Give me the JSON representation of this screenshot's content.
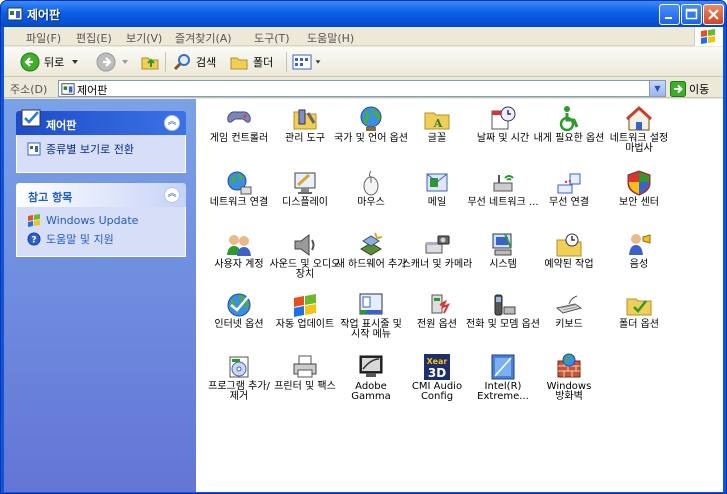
{
  "window": {
    "title": "제어판"
  },
  "menu": [
    "파일(F)",
    "편집(E)",
    "보기(V)",
    "즐겨찾기(A)",
    "도구(T)",
    "도움말(H)"
  ],
  "toolbar": {
    "back": "뒤로",
    "search": "검색",
    "folders": "폴더"
  },
  "address": {
    "label": "주소(D)",
    "value": "제어판",
    "go": "이동"
  },
  "sidebar": {
    "panel1": {
      "title": "제어판",
      "link": "종류별 보기로 전환"
    },
    "panel2": {
      "title": "참고 항목",
      "links": [
        "Windows Update",
        "도움말 및 지원"
      ]
    }
  },
  "items": [
    {
      "label": "게임 컨트롤러",
      "icon": "game-controller-icon"
    },
    {
      "label": "관리 도구",
      "icon": "admin-tools-icon"
    },
    {
      "label": "국가 및 언어 옵션",
      "icon": "globe-icon"
    },
    {
      "label": "글꼴",
      "icon": "fonts-folder-icon"
    },
    {
      "label": "날짜 및 시간",
      "icon": "clock-icon"
    },
    {
      "label": "내게 필요한 옵션",
      "icon": "accessibility-icon"
    },
    {
      "label": "네트워크 설정 마법사",
      "icon": "network-house-icon"
    },
    {
      "label": "네트워크 연결",
      "icon": "network-globe-icon"
    },
    {
      "label": "디스플레이",
      "icon": "display-icon"
    },
    {
      "label": "마우스",
      "icon": "mouse-icon"
    },
    {
      "label": "메일",
      "icon": "mail-icon"
    },
    {
      "label": "무선 네트워크 ...",
      "icon": "wireless-network-icon"
    },
    {
      "label": "무선 연결",
      "icon": "wireless-link-icon"
    },
    {
      "label": "보안 센터",
      "icon": "shield-icon"
    },
    {
      "label": "사용자 계정",
      "icon": "users-icon"
    },
    {
      "label": "사운드 및 오디오 장치",
      "icon": "speaker-icon"
    },
    {
      "label": "새 하드웨어 추가",
      "icon": "hardware-icon"
    },
    {
      "label": "스캐너 및 카메라",
      "icon": "scanner-icon"
    },
    {
      "label": "시스템",
      "icon": "system-icon"
    },
    {
      "label": "예약된 작업",
      "icon": "scheduled-tasks-icon"
    },
    {
      "label": "음성",
      "icon": "speech-icon"
    },
    {
      "label": "인터넷 옵션",
      "icon": "internet-icon"
    },
    {
      "label": "자동 업데이트",
      "icon": "windows-flag-icon"
    },
    {
      "label": "작업 표시줄 및 시작 메뉴",
      "icon": "taskbar-icon"
    },
    {
      "label": "전원 옵션",
      "icon": "power-icon"
    },
    {
      "label": "전화 및 모뎀 옵션",
      "icon": "phone-icon"
    },
    {
      "label": "키보드",
      "icon": "keyboard-icon"
    },
    {
      "label": "폴더 옵션",
      "icon": "folder-options-icon"
    },
    {
      "label": "프로그램 추가/제거",
      "icon": "add-remove-icon"
    },
    {
      "label": "프린터 및 팩스",
      "icon": "printer-icon"
    },
    {
      "label": "Adobe Gamma",
      "icon": "monitor-icon"
    },
    {
      "label": "CMI Audio Config",
      "icon": "xear-icon"
    },
    {
      "label": "Intel(R) Extreme...",
      "icon": "intel-icon"
    },
    {
      "label": "Windows 방화벽",
      "icon": "firewall-icon"
    }
  ],
  "colors": {
    "title_bar": "#0a5fe8",
    "sidebar": "#6c8fe0",
    "link": "#215dc6"
  }
}
